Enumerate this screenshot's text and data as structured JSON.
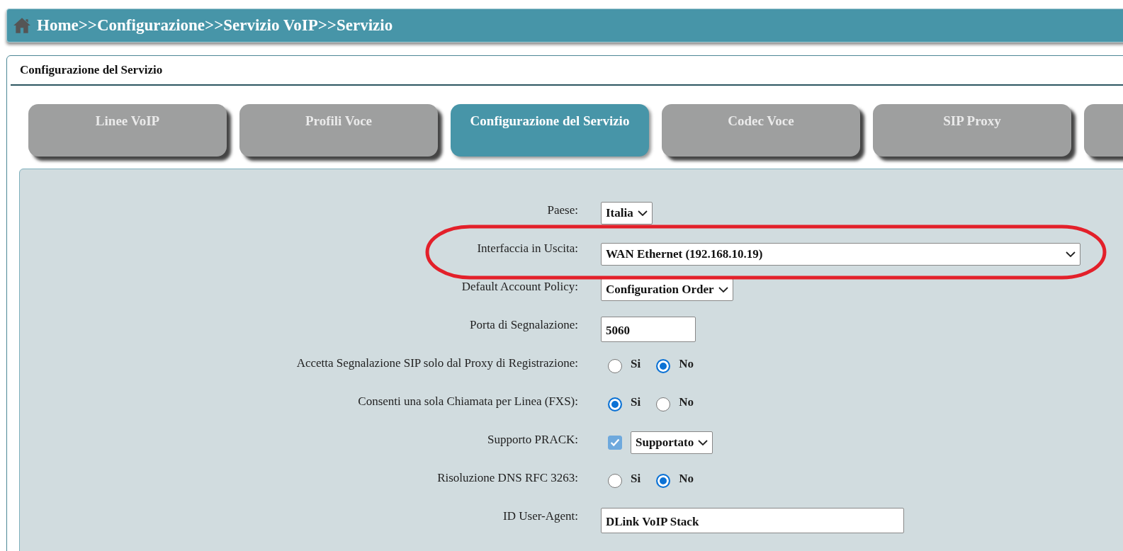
{
  "breadcrumb": "Home>>Configurazione>>Servizio VoIP>>Servizio",
  "panel": {
    "title": "Configurazione del Servizio"
  },
  "tabs": [
    {
      "label": "Linee VoIP",
      "selected": false
    },
    {
      "label": "Profili Voce",
      "selected": false
    },
    {
      "label": "Configurazione del Servizio",
      "selected": true
    },
    {
      "label": "Codec Voce",
      "selected": false
    },
    {
      "label": "SIP Proxy",
      "selected": false
    },
    {
      "selected": false
    }
  ],
  "fields": [
    {
      "kind": "select",
      "label": "Paese:",
      "value": "Italia"
    },
    {
      "kind": "select",
      "label": "Interfaccia in Uscita:",
      "value": "WAN Ethernet (192.168.10.19)",
      "highlighted": true
    },
    {
      "kind": "select",
      "label": "Default Account Policy:",
      "value": "Configuration Order"
    },
    {
      "kind": "text",
      "label": "Porta di Segnalazione:",
      "value": "5060"
    },
    {
      "kind": "radio",
      "label": "Accetta Segnalazione SIP solo dal Proxy di Registrazione:",
      "options": [
        {
          "label": "Si",
          "selected": false
        },
        {
          "label": "No",
          "selected": true
        }
      ]
    },
    {
      "kind": "radio",
      "label": "Consenti una sola Chiamata per Linea (FXS):",
      "options": [
        {
          "label": "Si",
          "selected": true
        },
        {
          "label": "No",
          "selected": false
        }
      ]
    },
    {
      "kind": "check_select",
      "label": "Supporto PRACK:",
      "checked": true,
      "value": "Supportato"
    },
    {
      "kind": "radio",
      "label": "Risoluzione DNS RFC 3263:",
      "options": [
        {
          "label": "Si",
          "selected": false
        },
        {
          "label": "No",
          "selected": true
        }
      ]
    },
    {
      "kind": "text",
      "label": "ID User-Agent:",
      "value": "DLink VoIP Stack"
    }
  ]
}
